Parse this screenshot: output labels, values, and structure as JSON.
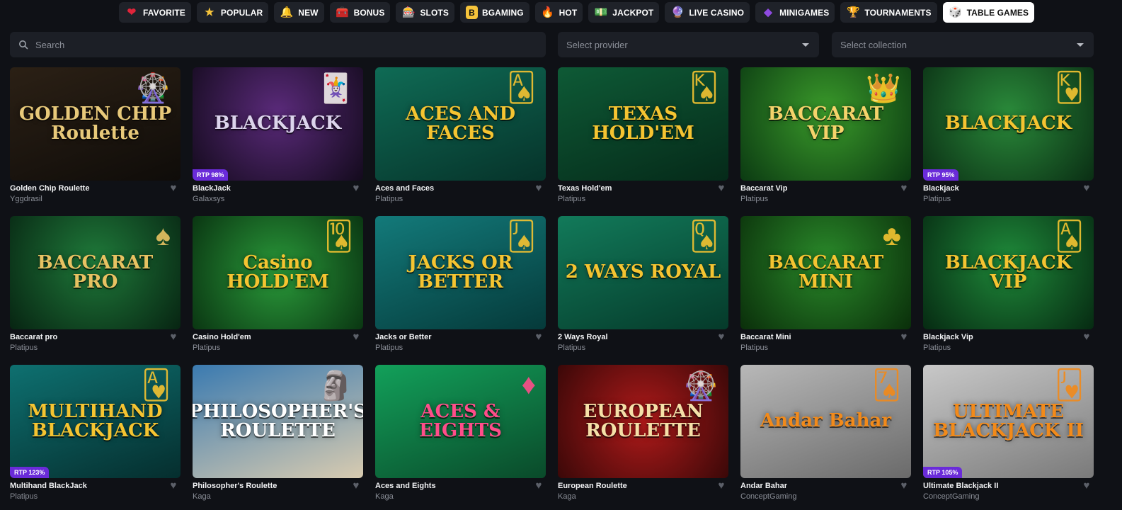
{
  "categories": [
    {
      "label": "FAVORITE",
      "icon": "heart-icon",
      "glyph": "❤",
      "color": "#e0243a"
    },
    {
      "label": "POPULAR",
      "icon": "star-icon",
      "glyph": "★",
      "color": "#f5c33b"
    },
    {
      "label": "NEW",
      "icon": "bell-icon",
      "glyph": "🔔",
      "color": "#f5b324"
    },
    {
      "label": "BONUS",
      "icon": "treasure-chest-icon",
      "glyph": "🧰",
      "color": "#e0892a"
    },
    {
      "label": "SLOTS",
      "icon": "slot-machine-icon",
      "glyph": "🎰",
      "color": "#e04646"
    },
    {
      "label": "BGAMING",
      "icon": "bgaming-logo-icon",
      "glyph": "B",
      "color": "#f5c33b"
    },
    {
      "label": "HOT",
      "icon": "fire-icon",
      "glyph": "🔥",
      "color": "#f0562a"
    },
    {
      "label": "JACKPOT",
      "icon": "money-icon",
      "glyph": "💵",
      "color": "#5fbf4a"
    },
    {
      "label": "LIVE CASINO",
      "icon": "crystal-ball-icon",
      "glyph": "🔮",
      "color": "#7aa7e8"
    },
    {
      "label": "MINIGAMES",
      "icon": "minigames-icon",
      "glyph": "◆",
      "color": "#8e4ae0"
    },
    {
      "label": "TOURNAMENTS",
      "icon": "trophy-icon",
      "glyph": "🏆",
      "color": "#e0a12a"
    },
    {
      "label": "TABLE GAMES",
      "icon": "dice-icon",
      "glyph": "🎲",
      "color": "#555555",
      "active": true
    }
  ],
  "filters": {
    "search_placeholder": "Search",
    "provider": "Select provider",
    "collection": "Select collection"
  },
  "games": [
    {
      "title": "Golden Chip Roulette",
      "provider": "Yggdrasil",
      "art": "GOLDEN CHIP Roulette",
      "bg": "linear-gradient(160deg,#2b2015,#0f0c09)",
      "fg": "#e8c97a",
      "deco": "🎡"
    },
    {
      "title": "BlackJack",
      "provider": "Galaxsys",
      "art": "BLACKJACK",
      "bg": "radial-gradient(circle at 50% 40%,#5a2a7a,#130a1c)",
      "fg": "#dcd4ec",
      "deco": "🃏",
      "rtp": "RTP 98%"
    },
    {
      "title": "Aces and Faces",
      "provider": "Platipus",
      "art": "ACES AND FACES",
      "bg": "linear-gradient(160deg,#0f6b55,#06332a)",
      "fg": "#f5c431",
      "deco": "🂡"
    },
    {
      "title": "Texas Hold'em",
      "provider": "Platipus",
      "art": "TEXAS HOLD'EM",
      "bg": "linear-gradient(160deg,#0e5a36,#052a19)",
      "fg": "#f5c431",
      "deco": "🂮"
    },
    {
      "title": "Baccarat Vip",
      "provider": "Platipus",
      "art": "BACCARAT VIP",
      "bg": "radial-gradient(circle at 50% 40%,#3a9a2a,#0b3a12)",
      "fg": "#f5d36b",
      "deco": "👑"
    },
    {
      "title": "Blackjack",
      "provider": "Platipus",
      "art": "BLACKJACK",
      "bg": "radial-gradient(circle at 50% 40%,#2a8a3a,#0a2e14)",
      "fg": "#f5c431",
      "deco": "🂾",
      "rtp": "RTP 95%"
    },
    {
      "title": "Baccarat pro",
      "provider": "Platipus",
      "art": "BACCARAT PRO",
      "bg": "radial-gradient(circle at 50% 40%,#1f7a3a,#072412)",
      "fg": "#e8c262",
      "deco": "♠"
    },
    {
      "title": "Casino Hold'em",
      "provider": "Platipus",
      "art": "Casino HOLD'EM",
      "bg": "radial-gradient(circle at 50% 50%,#2a9a3a,#0a3612)",
      "fg": "#f5c431",
      "deco": "🂪"
    },
    {
      "title": "Jacks or Better",
      "provider": "Platipus",
      "art": "JACKS OR BETTER",
      "bg": "linear-gradient(160deg,#137a7a,#053a3a)",
      "fg": "#f5c431",
      "deco": "🂫"
    },
    {
      "title": "2 Ways Royal",
      "provider": "Platipus",
      "art": "2 WAYS ROYAL",
      "bg": "linear-gradient(160deg,#127a5a,#053a2a)",
      "fg": "#f5c431",
      "deco": "🂭"
    },
    {
      "title": "Baccarat Mini",
      "provider": "Platipus",
      "art": "BACCARAT MINI",
      "bg": "radial-gradient(circle at 50% 40%,#2a8a2a,#0a2e0a)",
      "fg": "#f5c431",
      "deco": "♣"
    },
    {
      "title": "Blackjack Vip",
      "provider": "Platipus",
      "art": "BLACKJACK VIP",
      "bg": "radial-gradient(circle at 50% 40%,#1f8a3a,#062a12)",
      "fg": "#f5c431",
      "deco": "🂡"
    },
    {
      "title": "Multihand BlackJack",
      "provider": "Platipus",
      "art": "MULTIHAND BLACKJACK",
      "bg": "linear-gradient(160deg,#0e7070,#052e2e)",
      "fg": "#f5c431",
      "deco": "🂱",
      "rtp": "RTP 123%"
    },
    {
      "title": "Philosopher's Roulette",
      "provider": "Kaga",
      "art": "PHILOSOPHER'S ROULETTE",
      "bg": "linear-gradient(160deg,#3a7ab0,#d8cbb0)",
      "fg": "#ffffff",
      "deco": "🗿"
    },
    {
      "title": "Aces and Eights",
      "provider": "Kaga",
      "art": "ACES & EIGHTS",
      "bg": "linear-gradient(160deg,#12a05a,#0a4a2a)",
      "fg": "#ff4d8a",
      "deco": "♦"
    },
    {
      "title": "European Roulette",
      "provider": "Kaga",
      "art": "EUROPEAN ROULETTE",
      "bg": "radial-gradient(circle at 50% 50%,#b01a1a,#3a0808)",
      "fg": "#f5e0a8",
      "deco": "🎡"
    },
    {
      "title": "Andar Bahar",
      "provider": "ConceptGaming",
      "art": "Andar Bahar",
      "bg": "linear-gradient(160deg,#b8b8b8,#6a6a6a)",
      "fg": "#f28a1a",
      "deco": "🂧"
    },
    {
      "title": "Ultimate Blackjack II",
      "provider": "ConceptGaming",
      "art": "ULTIMATE BLACKJACK II",
      "bg": "linear-gradient(160deg,#c8c8c8,#7a7a7a)",
      "fg": "#f28a1a",
      "deco": "🂻",
      "rtp": "RTP 105%"
    }
  ]
}
